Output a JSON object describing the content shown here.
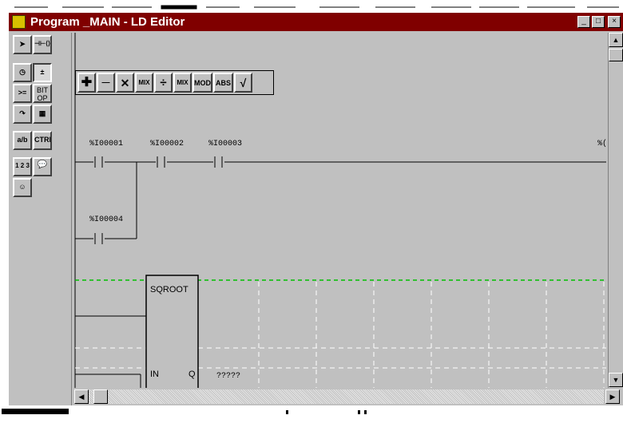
{
  "window": {
    "title": "Program _MAIN - LD Editor"
  },
  "title_buttons": [
    "_",
    "□",
    "×"
  ],
  "palette": {
    "items": [
      {
        "name": "select-arrow-icon",
        "glyph": "➤"
      },
      {
        "name": "contacts-coils-icon",
        "glyph": "⊣⊢⟨⟩"
      },
      {
        "name": "timer-icon",
        "glyph": "◷"
      },
      {
        "name": "math-icon",
        "glyph": "±"
      },
      {
        "name": "compare-icon",
        "glyph": ">="
      },
      {
        "name": "bit-op-button",
        "text": "BIT OP"
      },
      {
        "name": "jump-icon",
        "glyph": "↷"
      },
      {
        "name": "table-icon",
        "glyph": "▦"
      },
      {
        "name": "move-icon",
        "glyph": "a/b"
      },
      {
        "name": "ctrl-button",
        "text": "CTRL"
      },
      {
        "name": "conversion-icon",
        "glyph": "1 2 3"
      },
      {
        "name": "comment-icon",
        "glyph": "💬"
      },
      {
        "name": "face-icon",
        "glyph": "☺"
      }
    ]
  },
  "math_toolbar": {
    "buttons": [
      {
        "name": "add-button",
        "label": "✚"
      },
      {
        "name": "subtract-button",
        "label": "—"
      },
      {
        "name": "multiply-button",
        "label": "✕"
      },
      {
        "name": "multiply-mix-button",
        "label": "MIX"
      },
      {
        "name": "divide-button",
        "label": "÷"
      },
      {
        "name": "divide-mix-button",
        "label": "MIX"
      },
      {
        "name": "mod-button",
        "label": "MOD"
      },
      {
        "name": "abs-button",
        "label": "ABS"
      },
      {
        "name": "sqrt-button",
        "label": "√"
      }
    ]
  },
  "ladder": {
    "contacts": [
      {
        "label": "%I00001"
      },
      {
        "label": "%I00002"
      },
      {
        "label": "%I00003"
      },
      {
        "label": "%I00004"
      }
    ],
    "clipped_label": "%(",
    "function_block": {
      "name": "SQROOT",
      "input": "IN",
      "output": "Q",
      "output_value": "?????"
    }
  }
}
